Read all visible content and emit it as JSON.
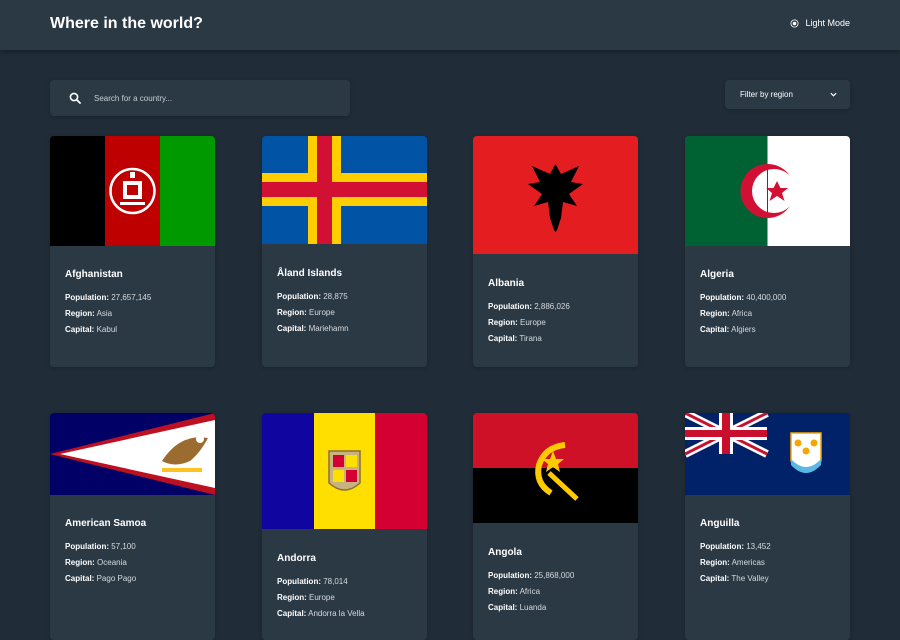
{
  "header": {
    "title": "Where in the world?",
    "mode_label": "Light Mode",
    "mode_icon": "sun-icon"
  },
  "search": {
    "placeholder": "Search for a country...",
    "value": "",
    "icon": "search-icon"
  },
  "filter": {
    "label": "Filter by region",
    "icon": "chevron-down-icon"
  },
  "labels": {
    "population": "Population:",
    "region": "Region:",
    "capital": "Capital:"
  },
  "colors": {
    "background": "#202c37",
    "surface": "#2b3945",
    "text": "#ffffff"
  },
  "countries": [
    {
      "name": "Afghanistan",
      "population": "27,657,145",
      "region": "Asia",
      "capital": "Kabul",
      "flag": "flag-afghanistan"
    },
    {
      "name": "Åland Islands",
      "population": "28,875",
      "region": "Europe",
      "capital": "Mariehamn",
      "flag": "flag-aland-islands"
    },
    {
      "name": "Albania",
      "population": "2,886,026",
      "region": "Europe",
      "capital": "Tirana",
      "flag": "flag-albania"
    },
    {
      "name": "Algeria",
      "population": "40,400,000",
      "region": "Africa",
      "capital": "Algiers",
      "flag": "flag-algeria"
    },
    {
      "name": "American Samoa",
      "population": "57,100",
      "region": "Oceania",
      "capital": "Pago Pago",
      "flag": "flag-american-samoa"
    },
    {
      "name": "Andorra",
      "population": "78,014",
      "region": "Europe",
      "capital": "Andorra la Vella",
      "flag": "flag-andorra"
    },
    {
      "name": "Angola",
      "population": "25,868,000",
      "region": "Africa",
      "capital": "Luanda",
      "flag": "flag-angola"
    },
    {
      "name": "Anguilla",
      "population": "13,452",
      "region": "Americas",
      "capital": "The Valley",
      "flag": "flag-anguilla"
    }
  ]
}
